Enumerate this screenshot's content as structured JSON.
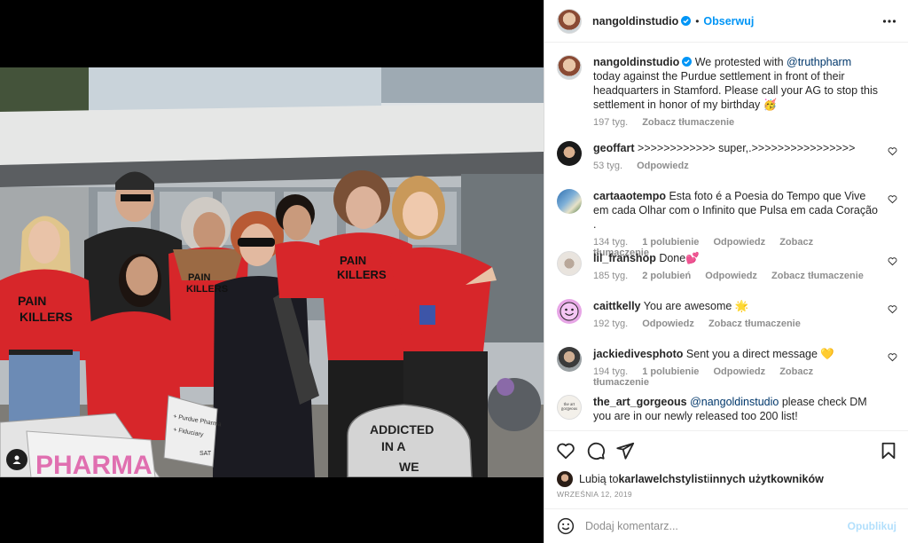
{
  "colors": {
    "accent": "#0095f6",
    "mention": "#00376b",
    "muted": "#8e8e8e",
    "shirt_red": "#d7262a"
  },
  "post": {
    "author": "nangoldinstudio",
    "follow_label": "Obserwuj",
    "more_icon": "more-horizontal-icon",
    "verified_icon": "verified-badge-icon"
  },
  "photo": {
    "shirt_text_1": "PAIN",
    "shirt_text_2": "KILLERS",
    "sign_right": [
      "ADDICTED",
      "IN A",
      "WE"
    ],
    "sign_left": "PHARMA",
    "sign_middle": [
      "+ Purdue Pharma",
      "+ Fiduciary",
      "SAT"
    ],
    "user_tag_icon": "user-tag-icon"
  },
  "caption": {
    "user": "nangoldinstudio",
    "text_before": "We protested with ",
    "mention": "@truthpharm",
    "text_after": " today against the Purdue settlement in front of their headquarters in Stamford. Please call your AG to stop this settlement in honor of my birthday 🥳",
    "time": "197 tyg.",
    "translate": "Zobacz tłumaczenie"
  },
  "comments": [
    {
      "user": "geoffart",
      "text": ">>>>>>>>>>>> super,.>>>>>>>>>>>>>>>>",
      "time": "53 tyg.",
      "likes": "",
      "reply": "Odpowiedz",
      "translate": ""
    },
    {
      "user": "cartaaotempo",
      "text": "Esta foto é a Poesia do Tempo que Vive em cada Olhar com o Infinito que Pulsa em cada Coração .",
      "time": "134 tyg.",
      "likes": "1 polubienie",
      "reply": "Odpowiedz",
      "translate": "Zobacz tłumaczenie"
    },
    {
      "user": "lil_franshop",
      "text": "Done💕",
      "time": "185 tyg.",
      "likes": "2 polubień",
      "reply": "Odpowiedz",
      "translate": "Zobacz tłumaczenie"
    },
    {
      "user": "caittkelly",
      "text": "You are awesome 🌟",
      "time": "192 tyg.",
      "likes": "",
      "reply": "Odpowiedz",
      "translate": "Zobacz tłumaczenie"
    },
    {
      "user": "jackiedivesphoto",
      "text": "Sent you a direct message 💛",
      "time": "194 tyg.",
      "likes": "1 polubienie",
      "reply": "Odpowiedz",
      "translate": "Zobacz tłumaczenie"
    },
    {
      "user": "the_art_gorgeous",
      "mention": "@nangoldinstudio",
      "text": " please check DM you are in our newly released too 200 list!",
      "avatar_text": "the art gorgeous"
    }
  ],
  "actions": {
    "like_icon": "heart-icon",
    "comment_icon": "comment-icon",
    "share_icon": "send-icon",
    "save_icon": "bookmark-icon",
    "likes_prefix": "Lubią to ",
    "likes_user": "karlawelchstylist",
    "likes_mid": " i ",
    "likes_others": "innych użytkowników",
    "date": "WRZEŚNIA 12, 2019"
  },
  "add_comment": {
    "emoji_icon": "emoji-icon",
    "placeholder": "Dodaj komentarz...",
    "publish_label": "Opublikuj"
  }
}
